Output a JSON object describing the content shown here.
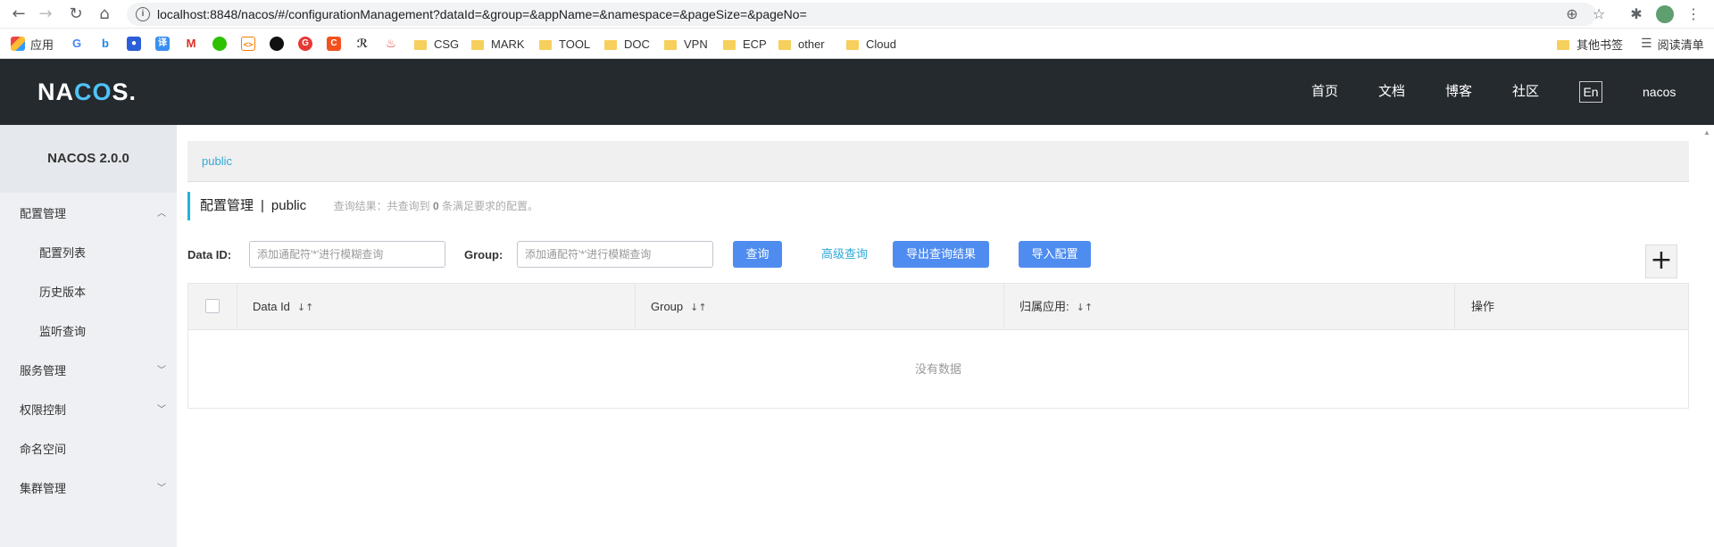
{
  "browser": {
    "url": "localhost:8848/nacos/#/configurationManagement?dataId=&group=&appName=&namespace=&pageSize=&pageNo=",
    "bookmarks": [
      "应用",
      "CSG",
      "MARK",
      "TOOL",
      "DOC",
      "VPN",
      "ECP",
      "other",
      "Cloud"
    ],
    "other_bookmarks": "其他书签",
    "reading_list": "阅读清单"
  },
  "header": {
    "logo_pre": "NA",
    "logo_o": "CO",
    "logo_post": "S.",
    "nav": [
      "首页",
      "文档",
      "博客",
      "社区"
    ],
    "lang": "En",
    "user": "nacos"
  },
  "sidebar": {
    "title": "NACOS 2.0.0",
    "items": [
      {
        "label": "配置管理",
        "chev": "^"
      },
      {
        "label": "配置列表"
      },
      {
        "label": "历史版本"
      },
      {
        "label": "监听查询"
      },
      {
        "label": "服务管理",
        "chev": "v"
      },
      {
        "label": "权限控制",
        "chev": "v"
      },
      {
        "label": "命名空间"
      },
      {
        "label": "集群管理",
        "chev": "v"
      }
    ]
  },
  "main": {
    "namespace_tab": "public",
    "title": "配置管理",
    "title_sep": "|",
    "title_ns": "public",
    "result_pre": "查询结果：共查询到",
    "result_count": "0",
    "result_post": "条满足要求的配置。",
    "filters": {
      "dataid_label": "Data ID:",
      "dataid_placeholder": "添加通配符'*'进行模糊查询",
      "group_label": "Group:",
      "group_placeholder": "添加通配符'*'进行模糊查询"
    },
    "buttons": {
      "query": "查询",
      "advanced": "高级查询",
      "export": "导出查询结果",
      "import": "导入配置",
      "add": "+"
    },
    "table": {
      "columns": [
        "Data Id",
        "Group",
        "归属应用:",
        "操作"
      ],
      "empty": "没有数据"
    }
  }
}
